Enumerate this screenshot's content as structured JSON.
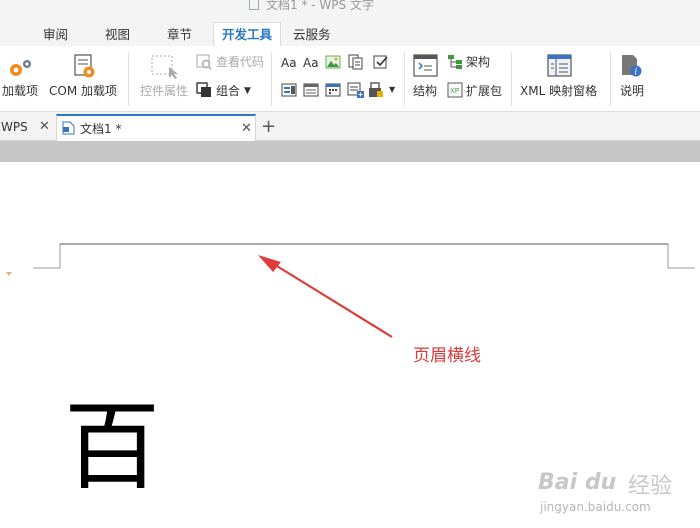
{
  "window": {
    "title": "文档1 * - WPS 文字"
  },
  "menu": {
    "tabs": [
      {
        "label": "审阅"
      },
      {
        "label": "视图"
      },
      {
        "label": "章节"
      },
      {
        "label": "开发工具",
        "active": true
      },
      {
        "label": "云服务"
      }
    ]
  },
  "ribbon": {
    "addins_label": "加载项",
    "com_addins_label": "COM 加载项",
    "control_props_label": "控件属性",
    "view_code_label": "查看代码",
    "group_label": "组合",
    "structure_label": "结构",
    "schema_label": "架构",
    "expansion_pack_label": "扩展包",
    "xml_pane_label": "XML 映射窗格",
    "help_label": "说明",
    "text_control_glyph": "Aa",
    "rich_text_control_glyph": "Aa"
  },
  "doc_tabs": [
    {
      "label": "WPS"
    },
    {
      "label": "文档1 *",
      "active": true
    }
  ],
  "document": {
    "annotation": "页眉横线",
    "big_character": "百"
  },
  "watermark": {
    "logo": "Bai du",
    "logo_suffix": "经验",
    "url": "jingyan.baidu.com"
  },
  "colors": {
    "accent": "#2b78c5",
    "annotation_red": "#e03a3a"
  }
}
